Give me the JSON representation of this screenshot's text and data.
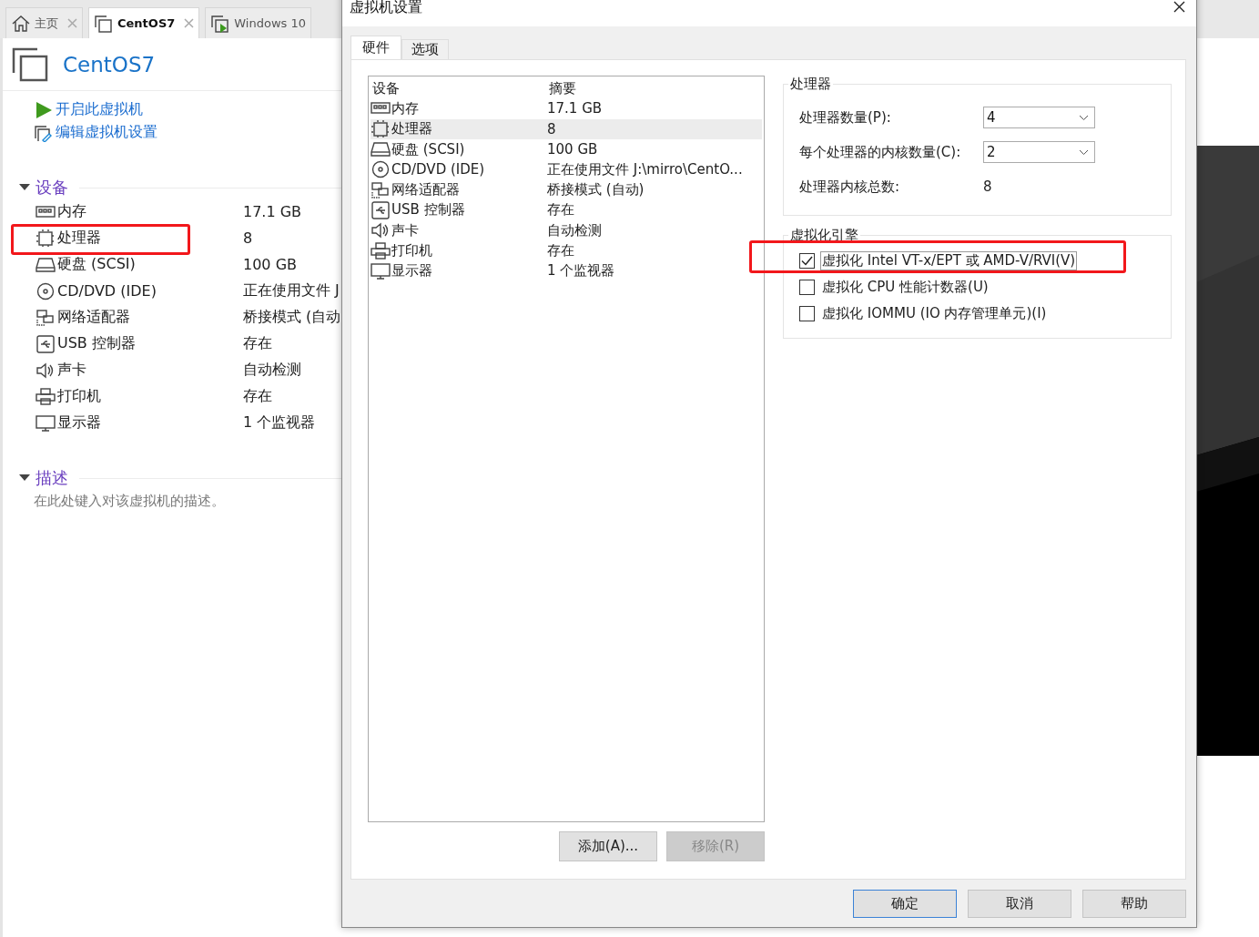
{
  "app_tabs": [
    {
      "label": "主页",
      "kind": "home",
      "selected": false,
      "closable": true
    },
    {
      "label": "CentOS7",
      "kind": "vm",
      "selected": true,
      "closable": true
    },
    {
      "label": "Windows 10",
      "kind": "vm-running",
      "selected": false,
      "closable": false
    }
  ],
  "vm": {
    "title": "CentOS7",
    "actions": [
      {
        "label": "开启此虚拟机",
        "kind": "play"
      },
      {
        "label": "编辑虚拟机设置",
        "kind": "edit"
      }
    ],
    "devices_section": {
      "title": "设备",
      "expanded": true,
      "items": [
        {
          "kind": "memory",
          "name": "内存",
          "summary": "17.1 GB",
          "highlighted": false
        },
        {
          "kind": "cpu",
          "name": "处理器",
          "summary": "8",
          "highlighted": true
        },
        {
          "kind": "disk",
          "name": "硬盘 (SCSI)",
          "summary": "100 GB",
          "highlighted": false
        },
        {
          "kind": "cdrom",
          "name": "CD/DVD (IDE)",
          "summary": "正在使用文件 J",
          "highlighted": false
        },
        {
          "kind": "network",
          "name": "网络适配器",
          "summary": "桥接模式 (自动",
          "highlighted": false
        },
        {
          "kind": "usb",
          "name": "USB 控制器",
          "summary": "存在",
          "highlighted": false
        },
        {
          "kind": "sound",
          "name": "声卡",
          "summary": "自动检测",
          "highlighted": false
        },
        {
          "kind": "printer",
          "name": "打印机",
          "summary": "存在",
          "highlighted": false
        },
        {
          "kind": "display",
          "name": "显示器",
          "summary": "1 个监视器",
          "highlighted": false
        }
      ]
    },
    "description_section": {
      "title": "描述",
      "expanded": true,
      "placeholder": "在此处键入对该虚拟机的描述。"
    }
  },
  "dialog": {
    "title": "虚拟机设置",
    "tabs": [
      {
        "label": "硬件",
        "selected": true
      },
      {
        "label": "选项",
        "selected": false
      }
    ],
    "device_table": {
      "columns": [
        "设备",
        "摘要"
      ],
      "rows": [
        {
          "kind": "memory",
          "device": "内存",
          "summary": "17.1 GB",
          "selected": false
        },
        {
          "kind": "cpu",
          "device": "处理器",
          "summary": "8",
          "selected": true
        },
        {
          "kind": "disk",
          "device": "硬盘 (SCSI)",
          "summary": "100 GB",
          "selected": false
        },
        {
          "kind": "cdrom",
          "device": "CD/DVD (IDE)",
          "summary": "正在使用文件 J:\\mirro\\CentO...",
          "selected": false
        },
        {
          "kind": "network",
          "device": "网络适配器",
          "summary": "桥接模式 (自动)",
          "selected": false
        },
        {
          "kind": "usb",
          "device": "USB 控制器",
          "summary": "存在",
          "selected": false
        },
        {
          "kind": "sound",
          "device": "声卡",
          "summary": "自动检测",
          "selected": false
        },
        {
          "kind": "printer",
          "device": "打印机",
          "summary": "存在",
          "selected": false
        },
        {
          "kind": "display",
          "device": "显示器",
          "summary": "1 个监视器",
          "selected": false
        }
      ]
    },
    "list_buttons": [
      {
        "label": "添加(A)...",
        "disabled": false
      },
      {
        "label": "移除(R)",
        "disabled": true
      }
    ],
    "processor": {
      "title": "处理器",
      "fields": [
        {
          "kind": "select",
          "label": "处理器数量(P):",
          "value": "4"
        },
        {
          "kind": "select",
          "label": "每个处理器的内核数量(C):",
          "value": "2"
        },
        {
          "kind": "text",
          "label": "处理器内核总数:",
          "value": "8"
        }
      ]
    },
    "virtualization": {
      "title": "虚拟化引擎",
      "options": [
        {
          "label": "虚拟化 Intel VT-x/EPT 或 AMD-V/RVI(V)",
          "checked": true,
          "highlighted": true
        },
        {
          "label": "虚拟化 CPU 性能计数器(U)",
          "checked": false,
          "highlighted": false
        },
        {
          "label": "虚拟化 IOMMU (IO 内存管理单元)(I)",
          "checked": false,
          "highlighted": false
        }
      ]
    },
    "footer_buttons": [
      {
        "label": "确定",
        "default": true
      },
      {
        "label": "取消",
        "default": false
      },
      {
        "label": "帮助",
        "default": false
      }
    ]
  }
}
